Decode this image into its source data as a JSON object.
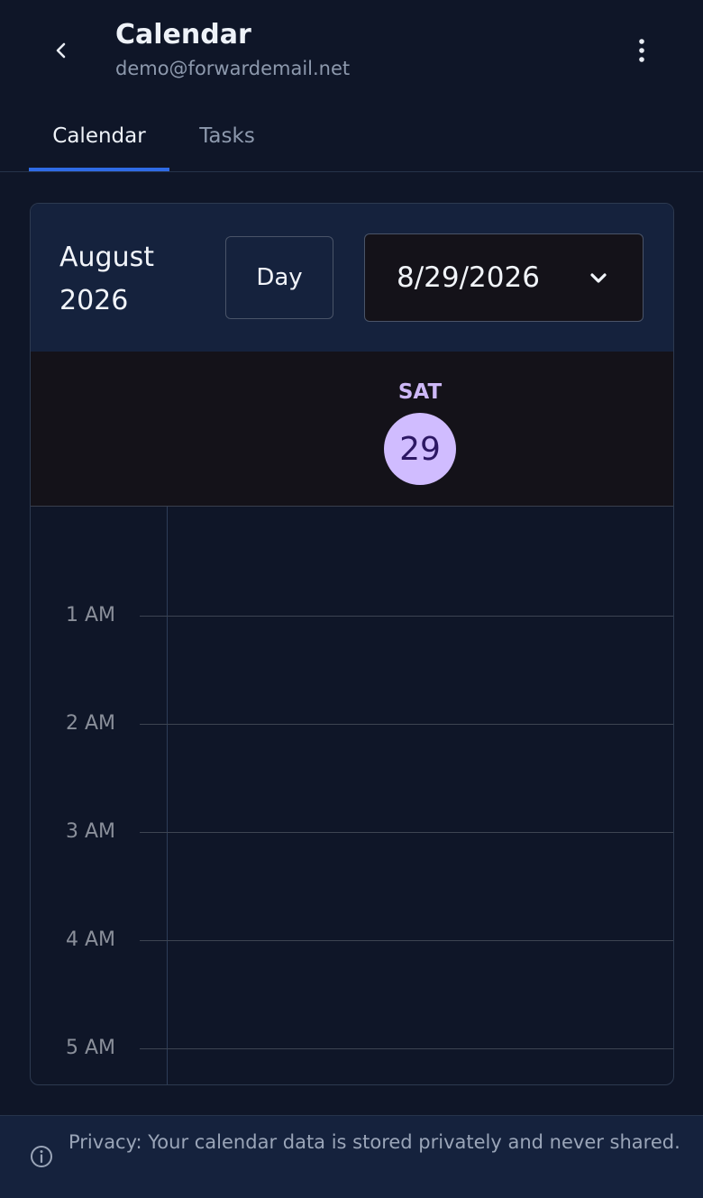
{
  "header": {
    "title": "Calendar",
    "subtitle": "demo@forwardemail.net",
    "back_icon": "chevron-left-icon",
    "more_icon": "more-vertical-icon"
  },
  "tabs": [
    {
      "label": "Calendar",
      "active": true
    },
    {
      "label": "Tasks",
      "active": false
    }
  ],
  "toolbar": {
    "month_label": "August 2026",
    "view_label": "Day",
    "date_value": "8/29/2026",
    "date_icon": "chevron-down-icon"
  },
  "day": {
    "weekday": "SAT",
    "date_number": "29"
  },
  "hours": [
    "1 AM",
    "2 AM",
    "3 AM",
    "4 AM",
    "5 AM"
  ],
  "privacy": {
    "text": "Privacy: Your calendar data is stored privately and never shared.",
    "icon": "info-icon"
  },
  "colors": {
    "background": "#0f1628",
    "accent": "#2f6be6",
    "today_circle": "#d0bcff",
    "weekday_text": "#cdb8f6"
  }
}
